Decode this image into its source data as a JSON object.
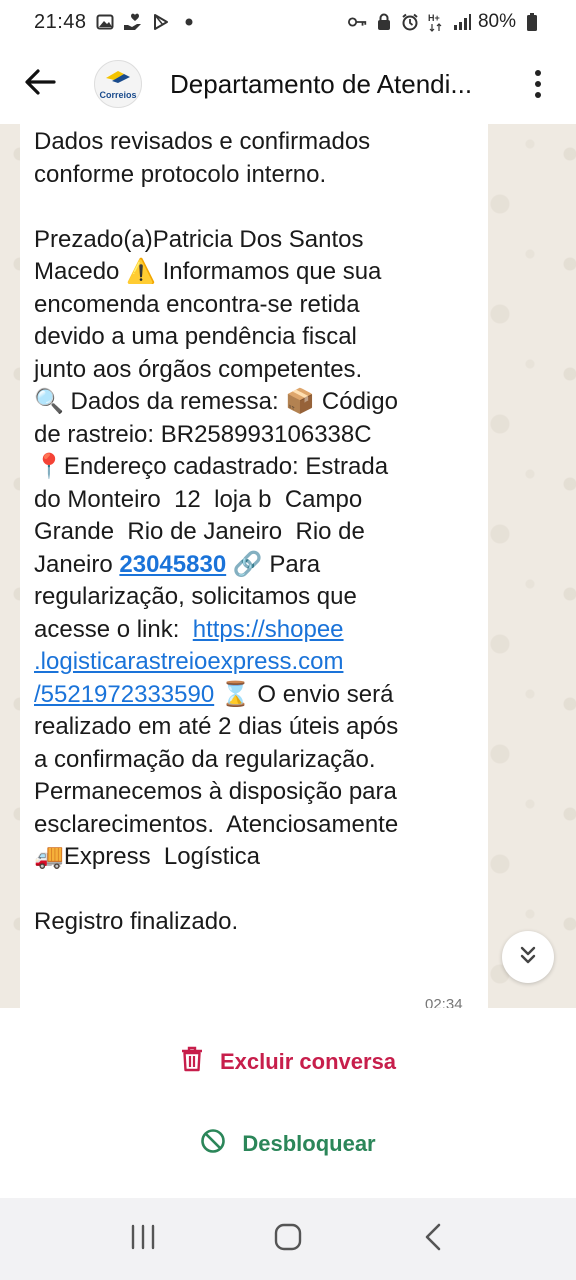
{
  "status_bar": {
    "time": "21:48",
    "battery": "80%",
    "left_icons": [
      "photo-icon",
      "hand-heart-icon",
      "play-store-icon",
      "dot-icon"
    ],
    "right_icons": [
      "key-icon",
      "lock-icon",
      "alarm-icon",
      "hplus-icon",
      "signal-icon",
      "battery-icon"
    ]
  },
  "header": {
    "title": "Departamento de Atendi...",
    "avatar_label": "Correios"
  },
  "message": {
    "line_confirmed": "Dados revisados e confirmados\nconforme protocolo interno.",
    "greeting": "Prezado(a)Patricia Dos Santos\nMacedo ",
    "warning_emoji": "⚠️",
    "body1": " Informamos que sua\nencomenda encontra-se retida\ndevido a uma pendência fiscal\njunto aos órgãos competentes.\n",
    "search_emoji": "🔍",
    "dados_remessa": " Dados da remessa: ",
    "package_emoji": "📦",
    "codigo": " Código\nde rastreio: BR258993106338C\n",
    "pin_emoji": "📍",
    "endereco": "Endereço cadastrado: Estrada\ndo Monteiro  12  loja b  Campo\nGrande  Rio de Janeiro  Rio de\nJaneiro ",
    "cep_link": "23045830",
    "link_emoji": "🔗",
    "para": " Para\nregularização, solicitamos que\nacesse o link:  ",
    "url": "https://shopee\n.logisticarastreioexpress.com\n/5521972333590",
    "hourglass_emoji": "⌛",
    "body2": " O envio será\nrealizado em até 2 dias úteis após\na confirmação da regularização.\nPermanecemos à disposição para\nesclarecimentos.  Atenciosamente\n",
    "truck_emoji": "🚚",
    "signature": "Express  Logística\n\n",
    "footer": "Registro finalizado.",
    "time": "02:34"
  },
  "actions": {
    "delete_label": "Excluir conversa",
    "unblock_label": "Desbloquear"
  },
  "colors": {
    "delete": "#c71e4b",
    "unblock": "#2b8659",
    "link": "#1a73d9",
    "chat_bg": "#efeae2"
  }
}
